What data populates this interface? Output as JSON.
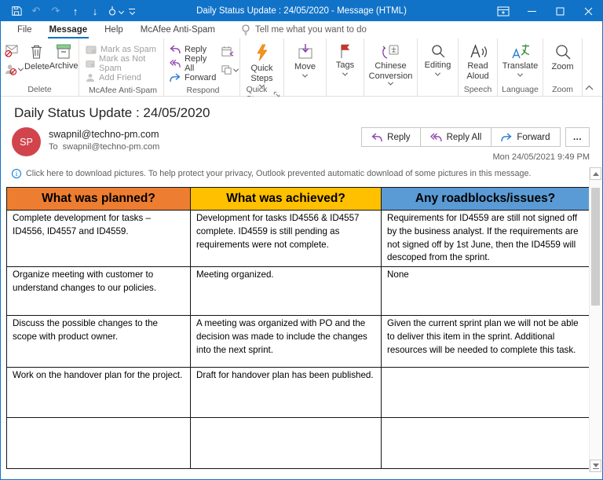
{
  "window": {
    "title": "Daily Status Update : 24/05/2020 - Message (HTML)"
  },
  "tabs": {
    "file": "File",
    "message": "Message",
    "help": "Help",
    "mcafee": "McAfee Anti-Spam",
    "tell_me": "Tell me what you want to do"
  },
  "ribbon": {
    "delete": {
      "group_label": "Delete",
      "delete_label": "Delete",
      "archive_label": "Archive"
    },
    "mcafee": {
      "group_label": "McAfee Anti-Spam",
      "mark_spam": "Mark as Spam",
      "mark_not_spam": "Mark as Not Spam",
      "add_friend": "Add Friend"
    },
    "respond": {
      "group_label": "Respond",
      "reply": "Reply",
      "reply_all": "Reply All",
      "forward": "Forward"
    },
    "quick_steps": {
      "group_label": "Quick Steps",
      "button_label": "Quick Steps"
    },
    "move": {
      "button_label": "Move"
    },
    "tags": {
      "button_label": "Tags"
    },
    "chinese": {
      "button_label": "Chinese Conversion"
    },
    "editing": {
      "button_label": "Editing"
    },
    "speech": {
      "group_label": "Speech",
      "read_aloud": "Read Aloud"
    },
    "language": {
      "group_label": "Language",
      "translate": "Translate"
    },
    "zoom": {
      "group_label": "Zoom",
      "zoom_label": "Zoom"
    }
  },
  "email": {
    "subject": "Daily Status Update : 24/05/2020",
    "avatar_initials": "SP",
    "from": "swapnil@techno-pm.com",
    "to_label": "To",
    "to": "swapnil@techno-pm.com",
    "sent": "Mon 24/05/2021 9:49 PM",
    "actions": {
      "reply": "Reply",
      "reply_all": "Reply All",
      "forward": "Forward",
      "more": "…"
    },
    "infobar": "Click here to download pictures. To help protect your privacy, Outlook prevented automatic download of some pictures in this message."
  },
  "status_table": {
    "headers": [
      "What was planned?",
      "What was achieved?",
      "Any roadblocks/issues?"
    ],
    "header_colors": [
      "#ED7D31",
      "#FFC000",
      "#5B9BD5"
    ],
    "rows": [
      [
        "Complete development for tasks – ID4556, ID4557 and ID4559.",
        "Development for tasks ID4556 & ID4557 complete. ID4559 is still pending as requirements were not complete.",
        "Requirements for ID4559 are still not signed off by the business analyst. If the requirements are not signed off by 1st June, then the ID4559 will descoped from the sprint."
      ],
      [
        "Organize meeting with customer to understand changes to our policies.",
        "Meeting organized.",
        "None"
      ],
      [
        "Discuss the possible changes to the scope with product owner.",
        "A meeting was organized with PO and the decision was made to include the changes into the next sprint.",
        "Given the current sprint plan we will not be able to deliver this item in the sprint. Additional resources will be needed to complete this task."
      ],
      [
        "Work on the handover plan for the project.",
        "Draft for handover plan has been published.",
        ""
      ],
      [
        "",
        "",
        ""
      ]
    ]
  },
  "colors": {
    "titlebar": "#1173C8",
    "accent": "#1072C6",
    "avatar": "#D2444C"
  }
}
